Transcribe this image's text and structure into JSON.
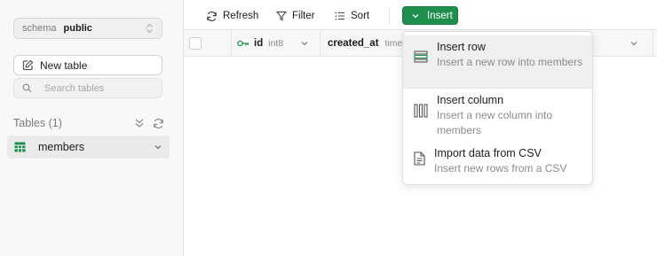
{
  "sidebar": {
    "schema_label": "schema",
    "schema_value": "public",
    "new_table_label": "New table",
    "search_placeholder": "Search tables",
    "tables_header": "Tables (1)",
    "tables": [
      {
        "label": "members"
      }
    ]
  },
  "toolbar": {
    "refresh_label": "Refresh",
    "filter_label": "Filter",
    "sort_label": "Sort",
    "insert_label": "Insert"
  },
  "grid": {
    "columns": [
      {
        "name": "id",
        "type": "int8",
        "key_icon": "key-icon"
      },
      {
        "name": "created_at",
        "type": "timestamptz"
      }
    ]
  },
  "insert_menu": {
    "items": [
      {
        "title": "Insert row",
        "description": "Insert a new row into members",
        "icon": "rows-icon"
      },
      {
        "title": "Insert column",
        "description": "Insert a new column into members",
        "icon": "columns-icon"
      },
      {
        "title": "Import data from CSV",
        "description": "Insert new rows from a CSV",
        "icon": "file-icon"
      }
    ]
  },
  "colors": {
    "accent": "#1f8f4d",
    "sidebar_bg": "#f8f8f8"
  }
}
